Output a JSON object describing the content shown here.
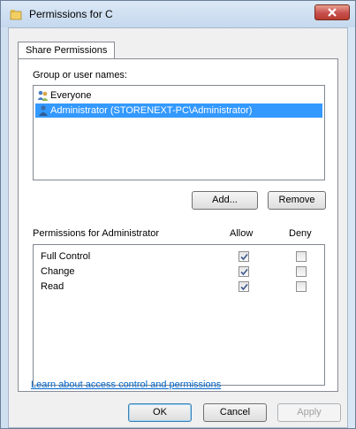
{
  "window": {
    "title": "Permissions for C"
  },
  "tabs": [
    {
      "label": "Share Permissions"
    }
  ],
  "group_section": {
    "label": "Group or user names:",
    "users": [
      {
        "name": "Everyone",
        "icon": "group-icon",
        "selected": false
      },
      {
        "name": "Administrator (STORENEXT-PC\\Administrator)",
        "icon": "user-icon",
        "selected": true
      }
    ]
  },
  "buttons": {
    "add": "Add...",
    "remove": "Remove",
    "ok": "OK",
    "cancel": "Cancel",
    "apply": "Apply"
  },
  "permissions": {
    "header": "Permissions for Administrator",
    "allow_label": "Allow",
    "deny_label": "Deny",
    "rows": [
      {
        "name": "Full Control",
        "allow": true,
        "deny": false
      },
      {
        "name": "Change",
        "allow": true,
        "deny": false
      },
      {
        "name": "Read",
        "allow": true,
        "deny": false
      }
    ]
  },
  "link_text": "Learn about access control and permissions",
  "colors": {
    "selection": "#3399ff",
    "link": "#0066cc",
    "close": "#c75050"
  }
}
